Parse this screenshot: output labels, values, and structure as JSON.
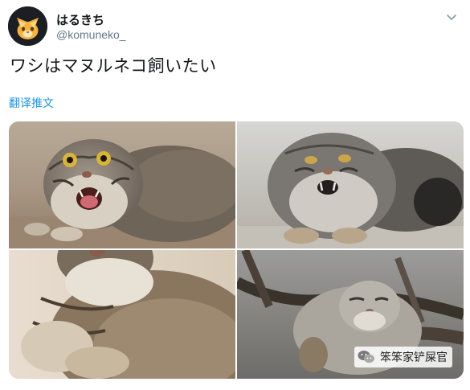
{
  "user": {
    "display_name": "はるきち",
    "handle": "@komuneko_"
  },
  "tweet": {
    "text": "ワシはマヌルネコ飼いたい",
    "translate_label": "翻译推文"
  },
  "watermark": {
    "text": "笨笨家铲屎官"
  },
  "colors": {
    "link": "#1b95e0",
    "handle": "#657786",
    "text": "#14171a"
  },
  "icons": {
    "avatar": "cat-face-icon",
    "menu": "chevron-down-icon",
    "watermark": "wechat-icon"
  }
}
